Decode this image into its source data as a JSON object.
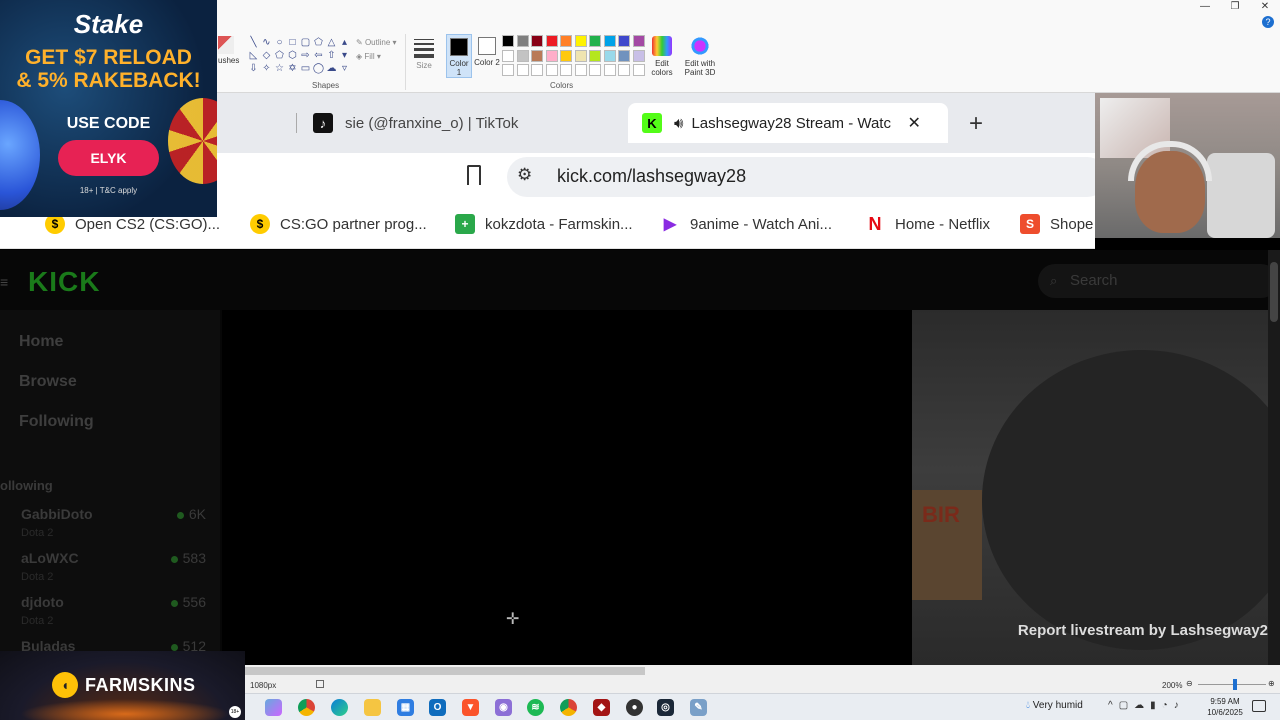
{
  "paint": {
    "brushes_label": "ushes",
    "outline_label": "Outline",
    "fill_label": "Fill",
    "shapes_group": "Shapes",
    "size_label": "Size",
    "color1_label": "Color 1",
    "color2_label": "Color 2",
    "colors_group": "Colors",
    "edit_colors_label": "Edit colors",
    "paint3d_label": "Edit with Paint 3D",
    "color1": "#000000",
    "color2": "#ffffff",
    "palette": [
      "#000000",
      "#7f7f7f",
      "#880015",
      "#ed1c24",
      "#ff7f27",
      "#fff200",
      "#22b14c",
      "#00a2e8",
      "#3f48cc",
      "#a349a4",
      "#ffffff",
      "#c3c3c3",
      "#b97a57",
      "#ffaec9",
      "#ffc90e",
      "#efe4b0",
      "#b5e61d",
      "#99d9ea",
      "#7092be",
      "#c8bfe7",
      "#ffffff",
      "#ffffff",
      "#ffffff",
      "#ffffff",
      "#ffffff",
      "#ffffff",
      "#ffffff",
      "#ffffff",
      "#ffffff",
      "#ffffff"
    ],
    "status": {
      "dimensions": "1080px",
      "zoom": "200%",
      "zoom_level": 0.55
    }
  },
  "stake_ad": {
    "logo": "Stake",
    "headline1": "GET $7 RELOAD",
    "headline2": "& 5% RAKEBACK!",
    "use_code": "USE CODE",
    "code": "ELYK",
    "terms": "18+ | T&C apply"
  },
  "browser": {
    "tabs": [
      {
        "title": "sie (@franxine_o) | TikTok",
        "active": false
      },
      {
        "title": "Lashsegway28 Stream - Watc",
        "active": true
      }
    ],
    "url": "kick.com/lashsegway28",
    "bookmarks": [
      {
        "label": "Open CS2 (CS:GO)...",
        "icon": "coin-icon"
      },
      {
        "label": "CS:GO partner prog...",
        "icon": "coin-icon"
      },
      {
        "label": "kokzdota - Farmskin...",
        "icon": "farmskins-icon"
      },
      {
        "label": "9anime - Watch Ani...",
        "icon": "play-icon"
      },
      {
        "label": "Home - Netflix",
        "icon": "netflix-icon"
      },
      {
        "label": "Shope",
        "icon": "shopee-icon"
      }
    ]
  },
  "kick": {
    "logo": "KICK",
    "search_placeholder": "Search",
    "nav": [
      "Home",
      "Browse",
      "Following"
    ],
    "following_header": "ollowing",
    "channels": [
      {
        "name": "GabbiDoto",
        "game": "Dota 2",
        "viewers": "6K"
      },
      {
        "name": "aLoWXC",
        "game": "Dota 2",
        "viewers": "583"
      },
      {
        "name": "djdoto",
        "game": "Dota 2",
        "viewers": "556"
      },
      {
        "name": "Buladas",
        "game": "",
        "viewers": "512"
      }
    ],
    "report_text": "Report livestream by Lashsegway2",
    "sign_text": "BIR"
  },
  "farm_ad": {
    "brand": "FARMSKINS",
    "age": "18+"
  },
  "taskbar": {
    "weather": "Very humid",
    "time": "9:59 AM",
    "date": "10/6/2025"
  }
}
